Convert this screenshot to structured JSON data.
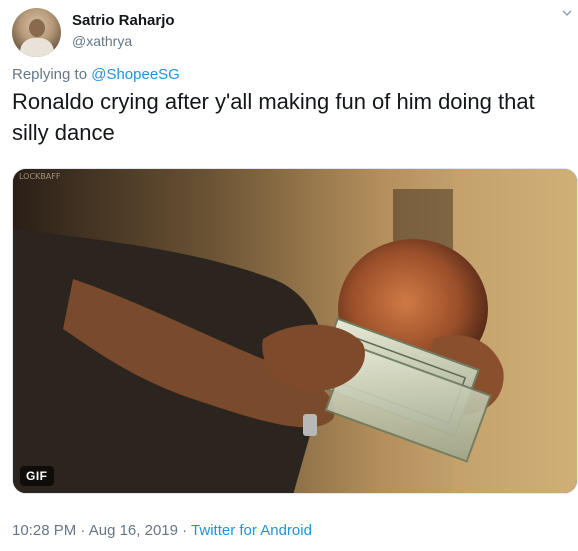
{
  "author": {
    "name": "Satrio Raharjo",
    "handle": "@xathrya"
  },
  "reply": {
    "prefix": "Replying to ",
    "mention": "@ShopeeSG"
  },
  "tweet": {
    "text": "Ronaldo crying after y'all making fun of him doing that silly dance"
  },
  "media": {
    "badge": "GIF"
  },
  "meta": {
    "time": "10:28 PM",
    "separator1": " · ",
    "date": "Aug 16, 2019",
    "separator2": " · ",
    "source": "Twitter for Android"
  },
  "colors": {
    "link": "#1b95e0",
    "secondary_text": "#657786",
    "primary_text": "#14171a"
  },
  "icons": {
    "menu": "chevron-down-icon"
  }
}
